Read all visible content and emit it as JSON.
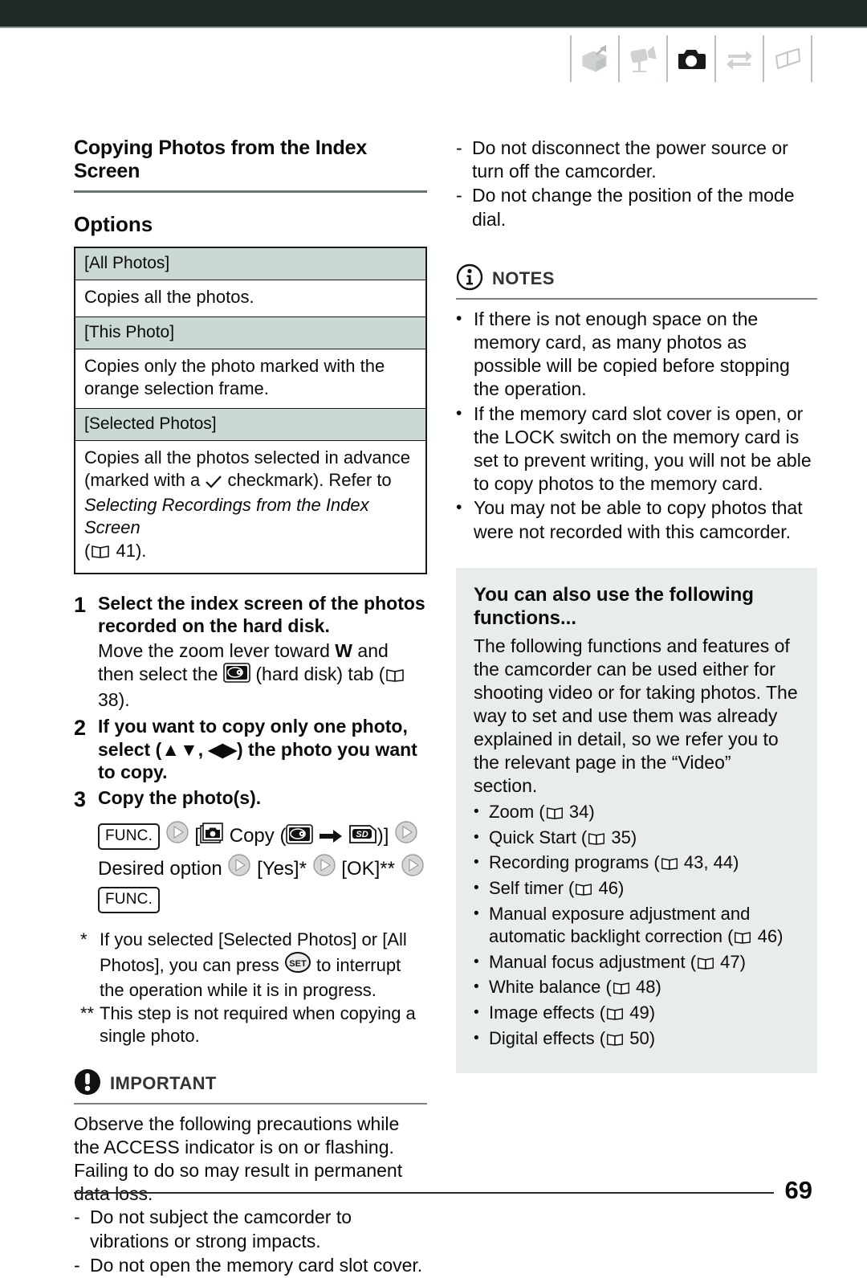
{
  "header": {
    "tabs": [
      {
        "name": "intro-tab",
        "icon": "open-box-icon",
        "active": false
      },
      {
        "name": "video-tab",
        "icon": "video-camera-icon",
        "active": false
      },
      {
        "name": "photos-tab",
        "icon": "photo-camera-icon",
        "active": true
      },
      {
        "name": "external-connections-tab",
        "icon": "transfer-arrows-icon",
        "active": false
      },
      {
        "name": "additional-information-tab",
        "icon": "open-book-icon",
        "active": false
      }
    ]
  },
  "left": {
    "section_title": "Copying Photos from the Index Screen",
    "sub_title": "Options",
    "options": [
      {
        "label": "[All Photos]",
        "description": "Copies all the photos."
      },
      {
        "label": "[This Photo]",
        "description": "Copies only the photo marked with the orange selection frame."
      },
      {
        "label": "[Selected Photos]",
        "description_part1": "Copies all the photos selected in advance (marked with a ",
        "description_part2": " checkmark). Refer to ",
        "description_italic": "Selecting Recordings from the Index Screen",
        "description_page": "41",
        "description_tail": ")."
      }
    ],
    "steps": [
      {
        "num": "1",
        "title": "Select the index screen of the photos recorded on the hard disk.",
        "desc_a": "Move the zoom lever toward ",
        "desc_w": "W",
        "desc_b": " and then select the ",
        "desc_c": " (hard disk) tab (",
        "desc_page": "38",
        "desc_d": ")."
      },
      {
        "num": "2",
        "title_a": "If you want to copy only one photo, select (",
        "title_updown": "▲▼",
        "title_b": ", ",
        "title_leftright": "◀▶",
        "title_c": ") the photo you want to copy."
      },
      {
        "num": "3",
        "title": "Copy the photo(s)."
      }
    ],
    "func_sequence": {
      "func_label": "FUNC.",
      "copy_open": "[",
      "copy_word": "Copy (",
      "copy_close": ")]",
      "desired_option": "Desired option",
      "yes": "[Yes]*",
      "ok": "[OK]**",
      "func_label_end": "FUNC."
    },
    "footnotes": [
      {
        "mark": "*",
        "text_a": "If you selected [Selected Photos] or [All Photos], you can press ",
        "icon": "SET",
        "text_b": " to interrupt the operation while it is in progress."
      },
      {
        "mark": "**",
        "text": "This step is not required when copying a single photo."
      }
    ],
    "important": {
      "heading": "IMPORTANT",
      "icon": "exclamation-icon",
      "intro": "Observe the following precautions while the ACCESS indicator is on or flashing. Failing to do so may result in permanent data loss.",
      "items": [
        "Do not subject the camcorder to vibrations or strong impacts.",
        "Do not open the memory card slot cover."
      ]
    }
  },
  "right": {
    "important_continued": [
      "Do not disconnect the power source or turn off the camcorder.",
      "Do not change the position of the mode dial."
    ],
    "notes": {
      "heading": "NOTES",
      "icon": "info-icon",
      "items": [
        "If there is not enough space on the memory card, as many photos as possible will be copied before stopping the operation.",
        "If the memory card slot cover is open, or the LOCK switch on the memory card is set to prevent writing, you will not be able to copy photos to the memory card.",
        "You may not be able to copy photos that were not recorded with this camcorder."
      ]
    },
    "graybox": {
      "heading": "You can also use the following functions...",
      "paragraph": "The following functions and features of the camcorder can be used either for shooting video or for taking photos. The way to set and use them was already explained in detail, so we refer you to the relevant page in the “Video” section.",
      "functions": [
        {
          "label": "Zoom",
          "pages": "34"
        },
        {
          "label": "Quick Start",
          "pages": "35"
        },
        {
          "label": "Recording programs",
          "pages": "43, 44"
        },
        {
          "label": "Self timer",
          "pages": "46"
        },
        {
          "label": "Manual exposure adjustment and automatic backlight correction",
          "pages": "46"
        },
        {
          "label": "Manual focus adjustment",
          "pages": "47"
        },
        {
          "label": "White balance",
          "pages": "48"
        },
        {
          "label": "Image effects",
          "pages": "49"
        },
        {
          "label": "Digital effects",
          "pages": "50"
        }
      ]
    }
  },
  "footer": {
    "page_number": "69"
  },
  "colors": {
    "topbar": "#222a29",
    "option_header_bg": "#ccd8d2",
    "graybox_bg": "#e8eced",
    "rule": "#6d7573",
    "text": "#0b0b0b"
  }
}
